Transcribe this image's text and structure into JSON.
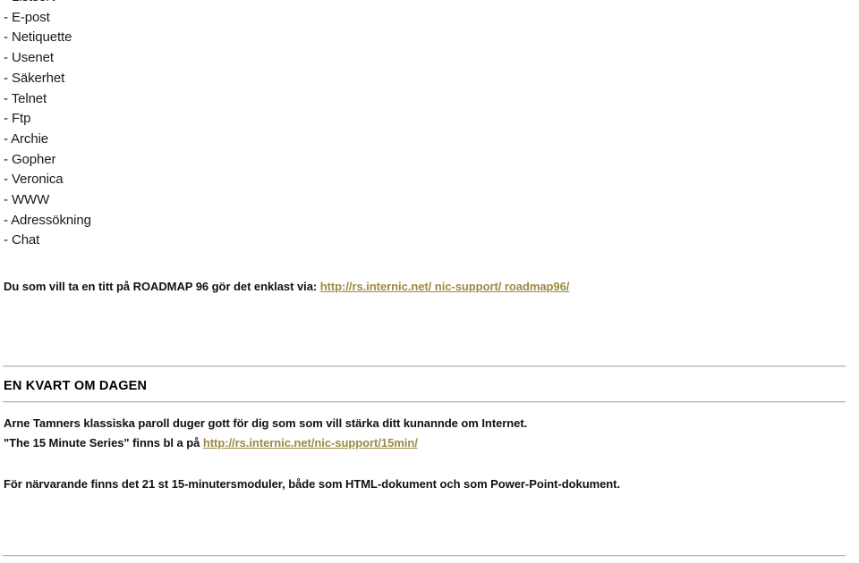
{
  "document": {
    "topic_list": [
      {
        "label": "- Listserv"
      },
      {
        "label": "- E-post"
      },
      {
        "label": "- Netiquette"
      },
      {
        "label": "- Usenet"
      },
      {
        "label": "- Säkerhet"
      },
      {
        "label": "- Telnet"
      },
      {
        "label": "- Ftp"
      },
      {
        "label": "- Archie"
      },
      {
        "label": "- Gopher"
      },
      {
        "label": "- Veronica"
      },
      {
        "label": "- WWW"
      },
      {
        "label": "- Adressökning"
      },
      {
        "label": "- Chat"
      }
    ],
    "roadmap": {
      "text": "Du som vill ta en titt på ROADMAP 96 gör det enklast via: ",
      "link_text": "http://rs.internic.net/ nic-support/ roadmap96/"
    },
    "section": {
      "heading": "EN KVART OM DAGEN",
      "paragraph_1": "Arne Tamners klassiska paroll duger gott för dig som som vill stärka ditt kunannde om Internet.",
      "paragraph_2_prefix": "\"The 15 Minute Series\" finns bl a på ",
      "paragraph_2_link": "http://rs.internic.net/nic-support/15min/",
      "paragraph_3": "För närvarande finns det 21 st 15-minutersmoduler, både som HTML-dokument och som Power-Point-dokument."
    },
    "colors": {
      "link": "#9c8a42",
      "text": "#111111",
      "rule": "#b4b4b4",
      "background": "#ffffff"
    }
  }
}
